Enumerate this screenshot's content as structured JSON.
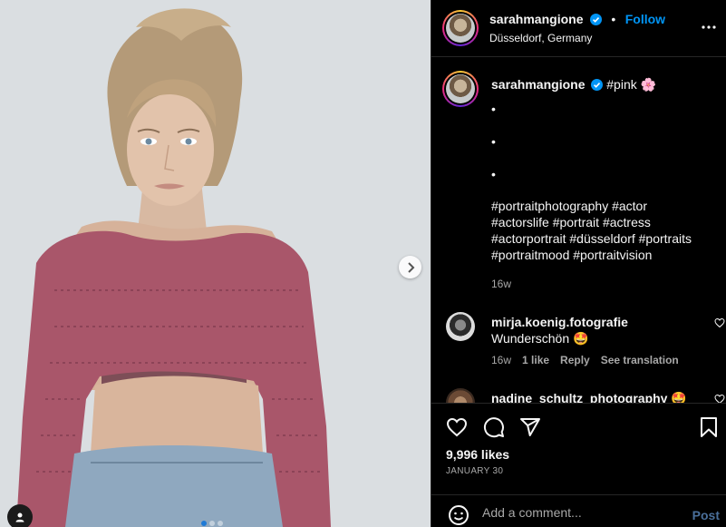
{
  "post": {
    "author": "sarahmangione",
    "follow_label": "Follow",
    "separator": "•",
    "location": "Düsseldorf, Germany",
    "caption_first": "#pink 🌸",
    "caption_dots": [
      "•",
      "•",
      "•"
    ],
    "hashtag_lines": [
      "#portraitphotography #actor",
      "#actorslife #portrait #actress",
      "#actorportrait #düsseldorf #portraits",
      "#portraitmood #portraitvision"
    ],
    "age": "16w"
  },
  "comments": [
    {
      "user": "mirja.koenig.fotografie",
      "text": "Wunderschön 🤩",
      "age": "16w",
      "likes": "1 like",
      "reply": "Reply",
      "translate": "See translation"
    },
    {
      "user": "nadine_schultz_photography",
      "text": "🤩"
    }
  ],
  "engagement": {
    "likes": "9,996 likes",
    "date": "JANUARY 30"
  },
  "composer": {
    "placeholder": "Add a comment...",
    "post_label": "Post"
  },
  "carousel": {
    "count": 3,
    "active": 0
  },
  "icons": {
    "verified": "verified-badge-icon",
    "more": "more-horizontal-icon",
    "heart": "heart-icon",
    "comment": "comment-icon",
    "share": "share-icon",
    "save": "bookmark-icon",
    "emoji": "emoji-icon",
    "next": "chevron-right-icon",
    "tag": "user-tag-icon"
  },
  "colors": {
    "accent": "#0095f6",
    "verified": "#0095f6"
  }
}
